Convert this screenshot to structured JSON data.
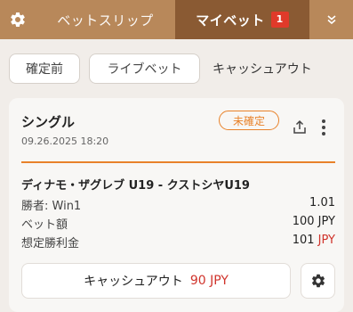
{
  "header": {
    "settings_icon": "gear-icon",
    "tabs": [
      {
        "label": "ベットスリップ"
      },
      {
        "label": "マイベット",
        "badge": "1"
      }
    ],
    "collapse_icon": "double-chevron-down-icon",
    "accent_color": "#b8885a",
    "active_tab_color": "#8a5a33",
    "badge_color": "#e03a2a"
  },
  "filters": {
    "items": [
      {
        "label": "確定前"
      },
      {
        "label": "ライブベット"
      },
      {
        "label": "キャッシュアウト"
      }
    ]
  },
  "bet": {
    "type": "シングル",
    "date": "09.26.2025 18:20",
    "status": "未確定",
    "status_color": "#e8822a",
    "share_icon": "share-icon",
    "more_icon": "more-vertical-icon",
    "match": "ディナモ・ザグレブ U19 - クストシヤU19",
    "rows": [
      {
        "label": "勝者: Win1",
        "value": "1.01"
      },
      {
        "label": "ベット額",
        "value": "100 JPY"
      },
      {
        "label": "想定勝利金",
        "amount": "101",
        "currency": "JPY"
      }
    ],
    "cashout": {
      "label": "キャッシュアウト",
      "amount": "90 JPY"
    },
    "settings_icon": "gear-icon"
  }
}
